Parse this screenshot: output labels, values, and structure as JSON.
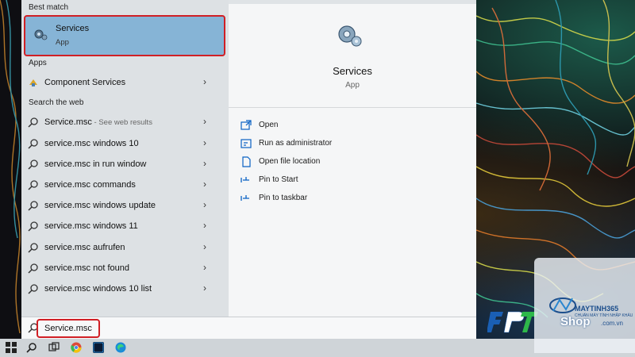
{
  "start_menu": {
    "best_match_label": "Best match",
    "best_match": {
      "title": "Services",
      "subtitle": "App"
    },
    "apps_label": "Apps",
    "apps": [
      {
        "label": "Component Services"
      }
    ],
    "web_label": "Search the web",
    "web_results": [
      {
        "label": "Service.msc",
        "hint": " - See web results"
      },
      {
        "label": "service.msc windows 10",
        "hint": ""
      },
      {
        "label": "service.msc in run window",
        "hint": ""
      },
      {
        "label": "service.msc commands",
        "hint": ""
      },
      {
        "label": "service.msc windows update",
        "hint": ""
      },
      {
        "label": "service.msc windows 11",
        "hint": ""
      },
      {
        "label": "service.msc aufrufen",
        "hint": ""
      },
      {
        "label": "service.msc not found",
        "hint": ""
      },
      {
        "label": "service.msc windows 10 list",
        "hint": ""
      }
    ],
    "chevron": "›"
  },
  "preview": {
    "title": "Services",
    "subtitle": "App",
    "actions": [
      {
        "label": "Open",
        "icon": "open-icon"
      },
      {
        "label": "Run as administrator",
        "icon": "run-as-admin-icon"
      },
      {
        "label": "Open file location",
        "icon": "file-location-icon"
      },
      {
        "label": "Pin to Start",
        "icon": "pin-icon"
      },
      {
        "label": "Pin to taskbar",
        "icon": "pin-icon"
      }
    ]
  },
  "search": {
    "query": "Service.msc"
  },
  "taskbar": {
    "items": [
      "windows-start-icon",
      "search-icon",
      "task-view-icon",
      "chrome-icon",
      "photoshop-icon",
      "edge-icon"
    ]
  },
  "watermark": {
    "fpt": "FPT",
    "brand": "MAYTINH365",
    "tagline": "CHUẨN MÁY TÍNH NHẬP KHẨU",
    "shop": "Shop",
    "domain": ".com.vn"
  },
  "colors": {
    "selection": "#86b4d6",
    "highlight_border": "#d01f25",
    "accent_blue": "#0a62c4"
  }
}
